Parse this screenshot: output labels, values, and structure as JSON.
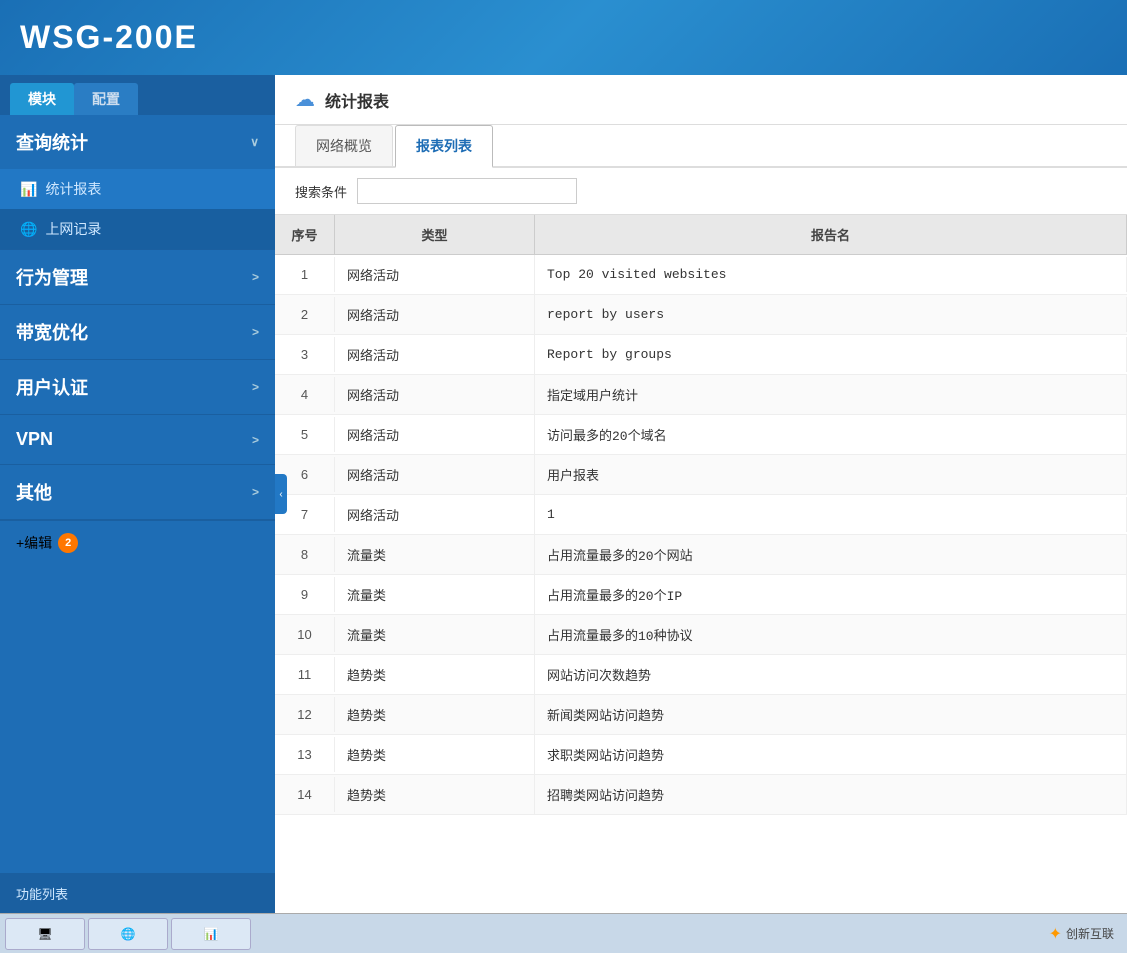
{
  "header": {
    "title": "WSG-200E"
  },
  "sidebar": {
    "tab_module": "模块",
    "tab_config": "配置",
    "nav_items": [
      {
        "id": "query-stats",
        "label": "查询统计",
        "arrow": "∨",
        "expanded": true
      },
      {
        "id": "stats-report",
        "label": "统计报表",
        "icon": "📊",
        "sub": true
      },
      {
        "id": "internet-log",
        "label": "上网记录",
        "icon": "🌐",
        "sub": true
      },
      {
        "id": "behavior",
        "label": "行为管理",
        "arrow": ">"
      },
      {
        "id": "bandwidth",
        "label": "带宽优化",
        "arrow": ">"
      },
      {
        "id": "user-auth",
        "label": "用户认证",
        "arrow": ">"
      },
      {
        "id": "vpn",
        "label": "VPN",
        "arrow": ">"
      },
      {
        "id": "other",
        "label": "其他",
        "arrow": ">"
      }
    ],
    "edit_label": "+编辑",
    "edit_badge": "2",
    "footer_label": "功能列表"
  },
  "content": {
    "header_title": "统计报表",
    "tabs": [
      {
        "id": "network-overview",
        "label": "网络概览"
      },
      {
        "id": "report-list",
        "label": "报表列表"
      }
    ],
    "active_tab": "report-list",
    "search_label": "搜索条件",
    "search_placeholder": "",
    "table": {
      "headers": [
        "序号",
        "类型",
        "报告名"
      ],
      "rows": [
        {
          "seq": "1",
          "type": "网络活动",
          "report": "Top  20  visited  websites"
        },
        {
          "seq": "2",
          "type": "网络活动",
          "report": "report  by  users"
        },
        {
          "seq": "3",
          "type": "网络活动",
          "report": "Report  by  groups"
        },
        {
          "seq": "4",
          "type": "网络活动",
          "report": "指定域用户统计"
        },
        {
          "seq": "5",
          "type": "网络活动",
          "report": "访问最多的20个域名"
        },
        {
          "seq": "6",
          "type": "网络活动",
          "report": "用户报表"
        },
        {
          "seq": "7",
          "type": "网络活动",
          "report": "1"
        },
        {
          "seq": "8",
          "type": "流量类",
          "report": "占用流量最多的20个网站"
        },
        {
          "seq": "9",
          "type": "流量类",
          "report": "占用流量最多的20个IP"
        },
        {
          "seq": "10",
          "type": "流量类",
          "report": "占用流量最多的10种协议"
        },
        {
          "seq": "11",
          "type": "趋势类",
          "report": "网站访问次数趋势"
        },
        {
          "seq": "12",
          "type": "趋势类",
          "report": "新闻类网站访问趋势"
        },
        {
          "seq": "13",
          "type": "趋势类",
          "report": "求职类网站访问趋势"
        },
        {
          "seq": "14",
          "type": "趋势类",
          "report": "招聘类网站访问趋势"
        }
      ]
    }
  },
  "taskbar": {
    "items": [
      "",
      "",
      ""
    ]
  },
  "bottom_logo": "创新互联"
}
